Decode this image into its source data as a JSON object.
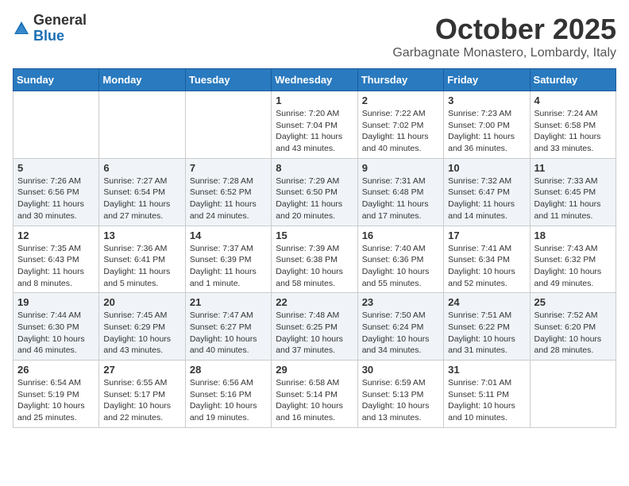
{
  "header": {
    "logo_line1": "General",
    "logo_line2": "Blue",
    "month": "October 2025",
    "location": "Garbagnate Monastero, Lombardy, Italy"
  },
  "columns": [
    "Sunday",
    "Monday",
    "Tuesday",
    "Wednesday",
    "Thursday",
    "Friday",
    "Saturday"
  ],
  "weeks": [
    [
      {
        "day": "",
        "info": ""
      },
      {
        "day": "",
        "info": ""
      },
      {
        "day": "",
        "info": ""
      },
      {
        "day": "1",
        "info": "Sunrise: 7:20 AM\nSunset: 7:04 PM\nDaylight: 11 hours\nand 43 minutes."
      },
      {
        "day": "2",
        "info": "Sunrise: 7:22 AM\nSunset: 7:02 PM\nDaylight: 11 hours\nand 40 minutes."
      },
      {
        "day": "3",
        "info": "Sunrise: 7:23 AM\nSunset: 7:00 PM\nDaylight: 11 hours\nand 36 minutes."
      },
      {
        "day": "4",
        "info": "Sunrise: 7:24 AM\nSunset: 6:58 PM\nDaylight: 11 hours\nand 33 minutes."
      }
    ],
    [
      {
        "day": "5",
        "info": "Sunrise: 7:26 AM\nSunset: 6:56 PM\nDaylight: 11 hours\nand 30 minutes."
      },
      {
        "day": "6",
        "info": "Sunrise: 7:27 AM\nSunset: 6:54 PM\nDaylight: 11 hours\nand 27 minutes."
      },
      {
        "day": "7",
        "info": "Sunrise: 7:28 AM\nSunset: 6:52 PM\nDaylight: 11 hours\nand 24 minutes."
      },
      {
        "day": "8",
        "info": "Sunrise: 7:29 AM\nSunset: 6:50 PM\nDaylight: 11 hours\nand 20 minutes."
      },
      {
        "day": "9",
        "info": "Sunrise: 7:31 AM\nSunset: 6:48 PM\nDaylight: 11 hours\nand 17 minutes."
      },
      {
        "day": "10",
        "info": "Sunrise: 7:32 AM\nSunset: 6:47 PM\nDaylight: 11 hours\nand 14 minutes."
      },
      {
        "day": "11",
        "info": "Sunrise: 7:33 AM\nSunset: 6:45 PM\nDaylight: 11 hours\nand 11 minutes."
      }
    ],
    [
      {
        "day": "12",
        "info": "Sunrise: 7:35 AM\nSunset: 6:43 PM\nDaylight: 11 hours\nand 8 minutes."
      },
      {
        "day": "13",
        "info": "Sunrise: 7:36 AM\nSunset: 6:41 PM\nDaylight: 11 hours\nand 5 minutes."
      },
      {
        "day": "14",
        "info": "Sunrise: 7:37 AM\nSunset: 6:39 PM\nDaylight: 11 hours\nand 1 minute."
      },
      {
        "day": "15",
        "info": "Sunrise: 7:39 AM\nSunset: 6:38 PM\nDaylight: 10 hours\nand 58 minutes."
      },
      {
        "day": "16",
        "info": "Sunrise: 7:40 AM\nSunset: 6:36 PM\nDaylight: 10 hours\nand 55 minutes."
      },
      {
        "day": "17",
        "info": "Sunrise: 7:41 AM\nSunset: 6:34 PM\nDaylight: 10 hours\nand 52 minutes."
      },
      {
        "day": "18",
        "info": "Sunrise: 7:43 AM\nSunset: 6:32 PM\nDaylight: 10 hours\nand 49 minutes."
      }
    ],
    [
      {
        "day": "19",
        "info": "Sunrise: 7:44 AM\nSunset: 6:30 PM\nDaylight: 10 hours\nand 46 minutes."
      },
      {
        "day": "20",
        "info": "Sunrise: 7:45 AM\nSunset: 6:29 PM\nDaylight: 10 hours\nand 43 minutes."
      },
      {
        "day": "21",
        "info": "Sunrise: 7:47 AM\nSunset: 6:27 PM\nDaylight: 10 hours\nand 40 minutes."
      },
      {
        "day": "22",
        "info": "Sunrise: 7:48 AM\nSunset: 6:25 PM\nDaylight: 10 hours\nand 37 minutes."
      },
      {
        "day": "23",
        "info": "Sunrise: 7:50 AM\nSunset: 6:24 PM\nDaylight: 10 hours\nand 34 minutes."
      },
      {
        "day": "24",
        "info": "Sunrise: 7:51 AM\nSunset: 6:22 PM\nDaylight: 10 hours\nand 31 minutes."
      },
      {
        "day": "25",
        "info": "Sunrise: 7:52 AM\nSunset: 6:20 PM\nDaylight: 10 hours\nand 28 minutes."
      }
    ],
    [
      {
        "day": "26",
        "info": "Sunrise: 6:54 AM\nSunset: 5:19 PM\nDaylight: 10 hours\nand 25 minutes."
      },
      {
        "day": "27",
        "info": "Sunrise: 6:55 AM\nSunset: 5:17 PM\nDaylight: 10 hours\nand 22 minutes."
      },
      {
        "day": "28",
        "info": "Sunrise: 6:56 AM\nSunset: 5:16 PM\nDaylight: 10 hours\nand 19 minutes."
      },
      {
        "day": "29",
        "info": "Sunrise: 6:58 AM\nSunset: 5:14 PM\nDaylight: 10 hours\nand 16 minutes."
      },
      {
        "day": "30",
        "info": "Sunrise: 6:59 AM\nSunset: 5:13 PM\nDaylight: 10 hours\nand 13 minutes."
      },
      {
        "day": "31",
        "info": "Sunrise: 7:01 AM\nSunset: 5:11 PM\nDaylight: 10 hours\nand 10 minutes."
      },
      {
        "day": "",
        "info": ""
      }
    ]
  ]
}
